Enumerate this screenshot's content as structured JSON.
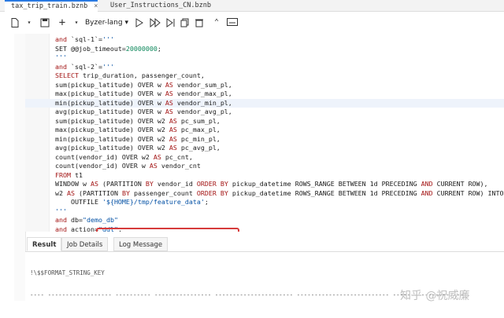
{
  "tabs": [
    {
      "label": "tax_trip_train.bznb",
      "close": "×"
    },
    {
      "label": "User_Instructions_CN.bznb"
    }
  ],
  "toolbar": {
    "language": "Byzer-lang"
  },
  "lines": [
    {
      "n": "",
      "html": "<span class=\"kw\">and</span> `sql-1`=<span class=\"str\">'''</span>"
    },
    {
      "n": "",
      "html": "SET @@job_timeout=<span class=\"num\">20000000</span>;"
    },
    {
      "n": "",
      "html": "<span class=\"str\">'''</span>"
    },
    {
      "n": "",
      "html": "<span class=\"kw\">and</span> `sql-2`=<span class=\"str\">'''</span>"
    },
    {
      "n": "",
      "html": "<span class=\"kw\">SELECT</span> trip_duration, passenger_count,"
    },
    {
      "n": "",
      "html": "sum(pickup_latitude) OVER w <span class=\"kw\">AS</span> vendor_sum_pl,"
    },
    {
      "n": "",
      "html": "max(pickup_latitude) OVER w <span class=\"kw\">AS</span> vendor_max_pl,"
    },
    {
      "n": "",
      "html": "min(pickup_latitude) OVER w <span class=\"kw\">AS</span> vendor_min_pl,",
      "hl": true
    },
    {
      "n": "",
      "html": "avg(pickup_latitude) OVER w <span class=\"kw\">AS</span> vendor_avg_pl,"
    },
    {
      "n": "",
      "html": "sum(pickup_latitude) OVER w2 <span class=\"kw\">AS</span> pc_sum_pl,"
    },
    {
      "n": "",
      "html": "max(pickup_latitude) OVER w2 <span class=\"kw\">AS</span> pc_max_pl,"
    },
    {
      "n": "",
      "html": "min(pickup_latitude) OVER w2 <span class=\"kw\">AS</span> pc_min_pl,"
    },
    {
      "n": "",
      "html": "avg(pickup_latitude) OVER w2 <span class=\"kw\">AS</span> pc_avg_pl,"
    },
    {
      "n": "",
      "html": "count(vendor_id) OVER w2 <span class=\"kw\">AS</span> pc_cnt,"
    },
    {
      "n": "",
      "html": "count(vendor_id) OVER w <span class=\"kw\">AS</span> vendor_cnt"
    },
    {
      "n": "",
      "html": "<span class=\"kw\">FROM</span> t1"
    },
    {
      "n": "",
      "html": "WINDOW w <span class=\"kw\">AS</span> (PARTITION <span class=\"kw\">BY</span> vendor_id <span class=\"kw\">ORDER BY</span> pickup_datetime ROWS_RANGE BETWEEN 1d PRECEDING <span class=\"kw\">AND</span> CURRENT ROW),"
    },
    {
      "n": "",
      "html": "w2 <span class=\"kw\">AS</span> (PARTITION <span class=\"kw\">BY</span> passenger_count <span class=\"kw\">ORDER BY</span> pickup_datetime ROWS_RANGE BETWEEN 1d PRECEDING <span class=\"kw\">AND</span> CURRENT ROW) INTO"
    },
    {
      "n": "",
      "html": "    OUTFILE <span class=\"str\">'${HOME}/tmp/feature_data'</span>;"
    },
    {
      "n": "",
      "html": "<span class=\"str\">'''</span>"
    },
    {
      "n": "",
      "html": "<span class=\"kw\">and</span> db=<span class=\"str\">\"demo_db\"</span>"
    },
    {
      "n": "",
      "html": "<span class=\"kw\">and</span> action=<span class=\"str\">\"ddl\"</span>;"
    }
  ],
  "result_tabs": [
    "Result",
    "Job Details",
    "Log Message"
  ],
  "result": {
    "line1": "!\\$$FORMAT_STRING_KEY",
    "line2": "---- ------------------ ---------- ---------------- ---------------------- -------------------------- --------------------"
  },
  "watermark": "知乎 @祝威廉"
}
